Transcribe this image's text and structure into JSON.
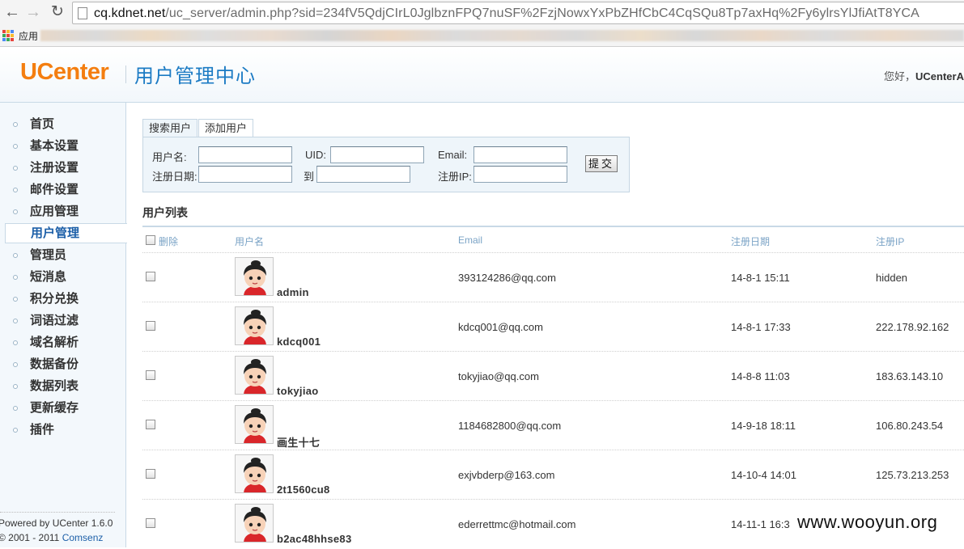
{
  "browser": {
    "url_host": "cq.kdnet.net",
    "url_path": "/uc_server/admin.php?sid=234fV5QdjCIrL0JglbznFPQ7nuSF%2FzjNowxYxPbZHfCbC4CqSQu8Tp7axHq%2Fy6ylrsYlJfiAtT8YCA",
    "apps_label": "应用"
  },
  "header": {
    "logo": "UCenter",
    "title": "用户管理中心",
    "greeting_prefix": "您好，",
    "greeting_user": "UCenterAd"
  },
  "sidebar": {
    "items": [
      {
        "label": "首页"
      },
      {
        "label": "基本设置"
      },
      {
        "label": "注册设置"
      },
      {
        "label": "邮件设置"
      },
      {
        "label": "应用管理"
      },
      {
        "label": "用户管理"
      },
      {
        "label": "管理员"
      },
      {
        "label": "短消息"
      },
      {
        "label": "积分兑换"
      },
      {
        "label": "词语过滤"
      },
      {
        "label": "域名解析"
      },
      {
        "label": "数据备份"
      },
      {
        "label": "数据列表"
      },
      {
        "label": "更新缓存"
      },
      {
        "label": "插件"
      }
    ],
    "active_item": "用户管理",
    "powered_by": "Powered by UCenter 1.6.0",
    "copyright_prefix": "© 2001 - 2011 ",
    "copyright_company": "Comsenz"
  },
  "search": {
    "tabs": [
      {
        "label": "搜索用户"
      },
      {
        "label": "添加用户"
      }
    ],
    "labels": {
      "username": "用户名:",
      "uid": "UID:",
      "email": "Email:",
      "regdate": "注册日期:",
      "to": "到",
      "regip": "注册IP:"
    },
    "values": {
      "username": "",
      "uid": "",
      "email": "",
      "regdate_from": "",
      "regdate_to": "",
      "regip": ""
    },
    "submit_label": "提交"
  },
  "user_list": {
    "title": "用户列表",
    "columns": {
      "delete": "删除",
      "username": "用户名",
      "email": "Email",
      "regdate": "注册日期",
      "regip": "注册IP"
    },
    "rows": [
      {
        "username": "admin",
        "email": "393124286@qq.com",
        "regdate": "14-8-1 15:11",
        "regip": "hidden"
      },
      {
        "username": "kdcq001",
        "email": "kdcq001@qq.com",
        "regdate": "14-8-1 17:33",
        "regip": "222.178.92.162"
      },
      {
        "username": "tokyjiao",
        "email": "tokyjiao@qq.com",
        "regdate": "14-8-8 11:03",
        "regip": "183.63.143.10"
      },
      {
        "username": "画生十七",
        "email": "1184682800@qq.com",
        "regdate": "14-9-18 18:11",
        "regip": "106.80.243.54"
      },
      {
        "username": "2t1560cu8",
        "email": "exjvbderp@163.com",
        "regdate": "14-10-4 14:01",
        "regip": "125.73.213.253"
      },
      {
        "username": "b2ac48hhse83",
        "email": "ederrettmc@hotmail.com",
        "regdate": "14-11-1 16:3",
        "regip": ""
      }
    ]
  },
  "watermark": "www.wooyun.org",
  "colors": {
    "logo": "#f47e10",
    "title": "#1c7bc4",
    "link": "#1c5fa8",
    "column_header": "#7aa3c6"
  }
}
